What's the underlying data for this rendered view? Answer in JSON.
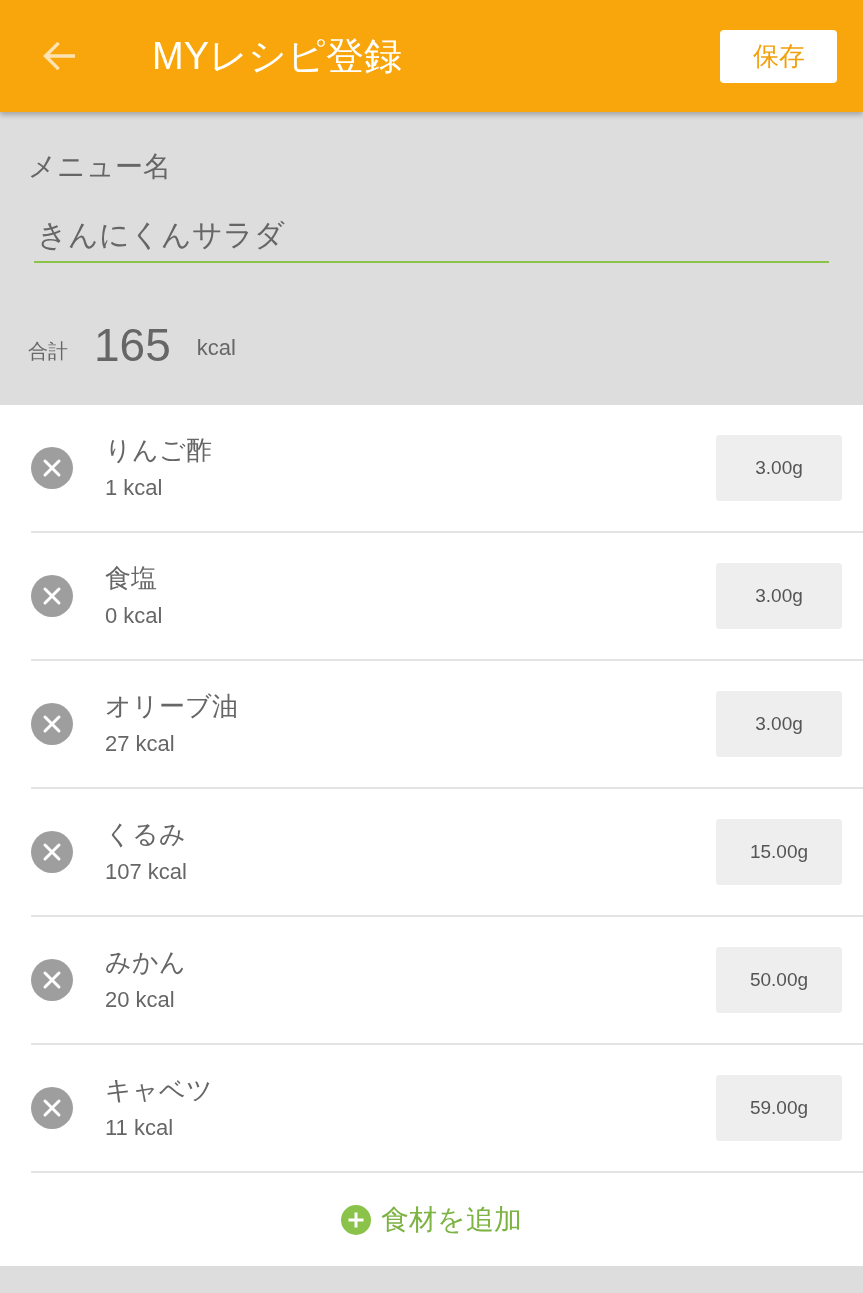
{
  "header": {
    "title": "MYレシピ登録",
    "save_button": "保存"
  },
  "menu_name": {
    "label": "メニュー名",
    "value": "きんにくんサラダ"
  },
  "total": {
    "label": "合計",
    "value": "165",
    "unit": "kcal"
  },
  "ingredients": [
    {
      "name": "りんご酢",
      "kcal": "1 kcal",
      "amount": "3.00g"
    },
    {
      "name": "食塩",
      "kcal": "0 kcal",
      "amount": "3.00g"
    },
    {
      "name": "オリーブ油",
      "kcal": "27 kcal",
      "amount": "3.00g"
    },
    {
      "name": "くるみ",
      "kcal": "107 kcal",
      "amount": "15.00g"
    },
    {
      "name": "みかん",
      "kcal": "20 kcal",
      "amount": "50.00g"
    },
    {
      "name": "キャベツ",
      "kcal": "11 kcal",
      "amount": "59.00g"
    }
  ],
  "add_button": "食材を追加"
}
